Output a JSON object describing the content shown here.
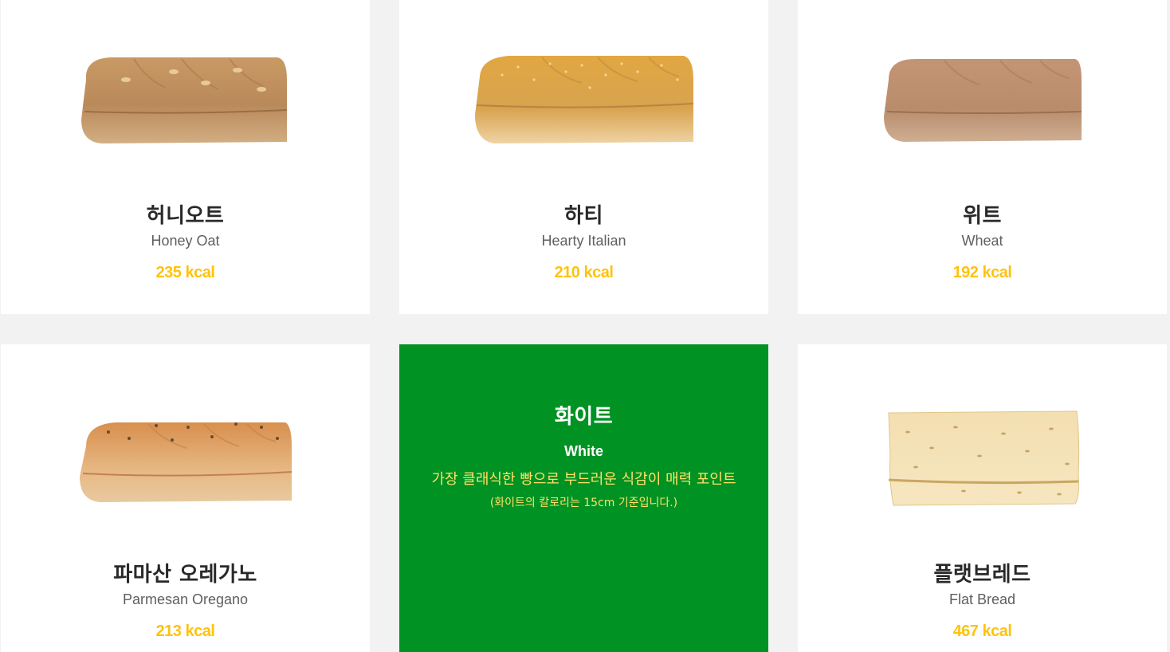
{
  "colors": {
    "page_background": "#f2f2f2",
    "card_background": "#ffffff",
    "active_card_background": "#009223",
    "kcal_color": "#ffc20d",
    "description_color": "#ffe168"
  },
  "breads": [
    {
      "name_ko": "허니오트",
      "name_en": "Honey Oat",
      "kcal": "235 kcal",
      "image": "honey-oat-bread-image"
    },
    {
      "name_ko": "하티",
      "name_en": "Hearty Italian",
      "kcal": "210 kcal",
      "image": "hearty-italian-bread-image"
    },
    {
      "name_ko": "위트",
      "name_en": "Wheat",
      "kcal": "192 kcal",
      "image": "wheat-bread-image"
    },
    {
      "name_ko": "파마산 오레가노",
      "name_en": "Parmesan Oregano",
      "kcal": "213 kcal",
      "image": "parmesan-oregano-bread-image"
    },
    {
      "name_ko": "화이트",
      "name_en": "White",
      "description": "가장 클래식한 빵으로 부드러운 식감이 매력 포인트",
      "note": "(화이트의 칼로리는 15cm 기준입니다.)",
      "active": true
    },
    {
      "name_ko": "플랫브레드",
      "name_en": "Flat Bread",
      "kcal": "467 kcal",
      "image": "flat-bread-image"
    }
  ]
}
